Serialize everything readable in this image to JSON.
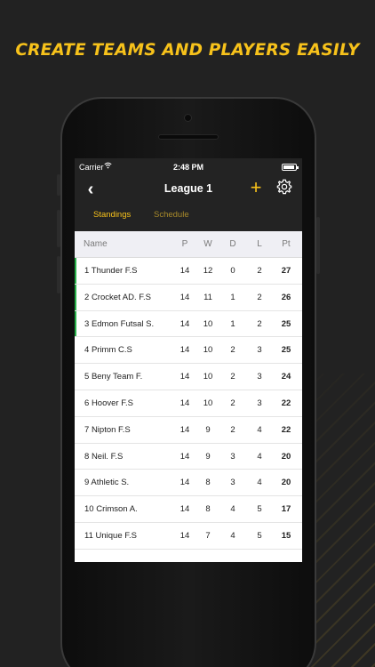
{
  "headline": "CREATE TEAMS AND PLAYERS EASILY",
  "status_bar": {
    "carrier": "Carrier",
    "wifi_icon": "wifi-icon",
    "time": "2:48 PM",
    "battery_icon": "battery-icon"
  },
  "nav": {
    "back_icon": "chevron-left-icon",
    "back_glyph": "‹",
    "title": "League 1",
    "add_icon": "plus-icon",
    "add_glyph": "+",
    "settings_icon": "gear-icon"
  },
  "tabs": [
    {
      "label": "Standings",
      "active": true
    },
    {
      "label": "Schedule",
      "active": false
    }
  ],
  "table": {
    "headers": {
      "name": "Name",
      "p": "P",
      "w": "W",
      "d": "D",
      "l": "L",
      "pt": "Pt"
    },
    "rows": [
      {
        "pos": "1",
        "team": "Thunder F.S",
        "p": "14",
        "w": "12",
        "d": "0",
        "l": "2",
        "pt": "27",
        "promotion": true
      },
      {
        "pos": "2",
        "team": "Crocket AD. F.S",
        "p": "14",
        "w": "11",
        "d": "1",
        "l": "2",
        "pt": "26",
        "promotion": true
      },
      {
        "pos": "3",
        "team": "Edmon Futsal S.",
        "p": "14",
        "w": "10",
        "d": "1",
        "l": "2",
        "pt": "25",
        "promotion": true
      },
      {
        "pos": "4",
        "team": "Primm C.S",
        "p": "14",
        "w": "10",
        "d": "2",
        "l": "3",
        "pt": "25",
        "promotion": false
      },
      {
        "pos": "5",
        "team": "Beny Team F.",
        "p": "14",
        "w": "10",
        "d": "2",
        "l": "3",
        "pt": "24",
        "promotion": false
      },
      {
        "pos": "6",
        "team": "Hoover F.S",
        "p": "14",
        "w": "10",
        "d": "2",
        "l": "3",
        "pt": "22",
        "promotion": false
      },
      {
        "pos": "7",
        "team": "Nipton F.S",
        "p": "14",
        "w": "9",
        "d": "2",
        "l": "4",
        "pt": "22",
        "promotion": false
      },
      {
        "pos": "8",
        "team": "Neil. F.S",
        "p": "14",
        "w": "9",
        "d": "3",
        "l": "4",
        "pt": "20",
        "promotion": false
      },
      {
        "pos": "9",
        "team": "Athletic S.",
        "p": "14",
        "w": "8",
        "d": "3",
        "l": "4",
        "pt": "20",
        "promotion": false
      },
      {
        "pos": "10",
        "team": "Crimson A.",
        "p": "14",
        "w": "8",
        "d": "4",
        "l": "5",
        "pt": "17",
        "promotion": false
      },
      {
        "pos": "11",
        "team": "Unique F.S",
        "p": "14",
        "w": "7",
        "d": "4",
        "l": "5",
        "pt": "15",
        "promotion": false
      }
    ]
  },
  "colors": {
    "accent": "#f7c21b",
    "promotion": "#28b04a",
    "header_bg": "#232323",
    "background": "#222222"
  }
}
